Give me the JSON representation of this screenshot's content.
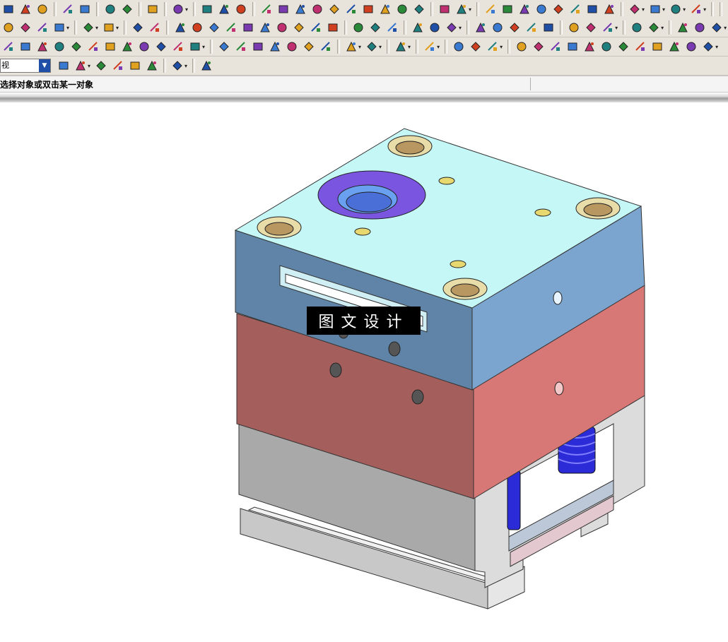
{
  "toolbar": {
    "rows": [
      {
        "icons": [
          "copy-icon",
          "paste-icon",
          "delete-icon",
          "sep",
          "undo-icon",
          "redo-icon",
          "sep",
          "edit-icon",
          "transform-icon",
          "sep",
          "select-icon",
          "sep",
          "find-icon",
          "dropdown",
          "sep",
          "blend-icon",
          "layer-icon",
          "layer2-icon",
          "sep",
          "snap-icon",
          "curve-icon",
          "point-icon",
          "axis-icon",
          "measure-icon",
          "route-icon",
          "pick-icon",
          "pick2-icon",
          "pick3-icon",
          "pick4-icon",
          "sep",
          "ruler-icon",
          "layer3-icon",
          "dropdown",
          "sep",
          "fit-icon",
          "rect-icon",
          "zoom-window-icon",
          "zoom-icon",
          "rotate-icon",
          "pan-icon",
          "shade-icon",
          "render-icon",
          "sep",
          "cube-view-icon",
          "dropdown",
          "sphere-icon",
          "dropdown",
          "palette-icon",
          "dropdown",
          "square-icon",
          "dropdown",
          "sep",
          "sep"
        ]
      },
      {
        "icons": [
          "feature-icon",
          "feature2-icon",
          "feature3-icon",
          "feature4-icon",
          "dropdown",
          "sep",
          "solid-icon",
          "dropdown",
          "box-icon",
          "dropdown",
          "sep",
          "shell-icon",
          "sphere2-icon",
          "sep",
          "cube-icon",
          "blend2-icon",
          "chamfer-icon",
          "extrude-icon",
          "book-icon",
          "book2-icon",
          "block-icon",
          "plate-icon",
          "cube2-icon",
          "cylinder-icon",
          "sep",
          "slab-icon",
          "slab2-icon",
          "slab3-icon",
          "sep",
          "assembly-icon",
          "tree-icon",
          "assembly2-icon",
          "dropdown",
          "sep",
          "line-icon",
          "arc-icon",
          "plus-icon",
          "rectangle-icon",
          "hexagon-icon",
          "sep",
          "spring-icon",
          "hook-icon",
          "fork-icon",
          "dropdown",
          "sep",
          "tool-icon",
          "tool2-icon",
          "dropdown",
          "sep",
          "mold-icon",
          "mold2-icon",
          "mold3-icon",
          "dropdown"
        ]
      },
      {
        "icons": [
          "diag-icon",
          "circle-icon",
          "hatch-icon",
          "grid-icon",
          "stack-icon",
          "frame-icon",
          "pen-icon",
          "diamond-icon",
          "check-icon",
          "close-icon",
          "layer4-icon",
          "box2-icon",
          "dropdown",
          "sep",
          "part1-icon",
          "part2-icon",
          "part3-icon",
          "part4-icon",
          "part5-icon",
          "part6-icon",
          "part7-icon",
          "sep",
          "group-icon",
          "dropdown",
          "group2-icon",
          "dropdown",
          "sep",
          "group3-icon",
          "dropdown",
          "sep",
          "hex-icon",
          "dropdown",
          "sep",
          "core-icon",
          "cavity-icon",
          "split-icon",
          "dropdown",
          "sep",
          "pin-icon",
          "pin2-icon",
          "pin3-icon",
          "pin4-icon",
          "pin5-icon",
          "pin6-icon",
          "pin7-icon",
          "pin8-icon",
          "pin9-icon",
          "pin10-icon",
          "pin11-icon",
          "pin12-icon",
          "dropdown"
        ]
      }
    ],
    "combo_value": "视",
    "row4_icons": [
      "layer-view-icon",
      "snap-point-icon",
      "dropdown",
      "arrow-back-icon",
      "view-cube-icon",
      "view-cube2-icon",
      "cursor-icon",
      "sep",
      "marquee-icon",
      "dropdown",
      "sep",
      "shaded-box-icon"
    ]
  },
  "status": {
    "prompt": "选择对象或双击某一对象"
  },
  "watermark": {
    "text": "图文设计"
  },
  "colors": {
    "top_face": "#c6f7f7",
    "top_plate_front": "#5f84a7",
    "top_plate_side": "#7ba5cf",
    "middle_plate_front": "#a45e5c",
    "middle_plate_side": "#d87876",
    "bottom_plate_front": "#a8a8a8",
    "bottom_plate_side": "#d8d8d8",
    "bushing": "#d8c89a",
    "sprue": "#7a55e0",
    "spring": "#1f1fd8"
  }
}
